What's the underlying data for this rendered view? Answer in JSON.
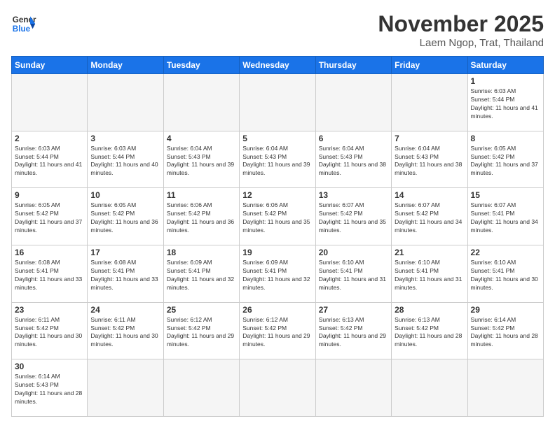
{
  "header": {
    "logo_general": "General",
    "logo_blue": "Blue",
    "month_title": "November 2025",
    "location": "Laem Ngop, Trat, Thailand"
  },
  "days_of_week": [
    "Sunday",
    "Monday",
    "Tuesday",
    "Wednesday",
    "Thursday",
    "Friday",
    "Saturday"
  ],
  "weeks": [
    [
      {
        "day": "",
        "empty": true
      },
      {
        "day": "",
        "empty": true
      },
      {
        "day": "",
        "empty": true
      },
      {
        "day": "",
        "empty": true
      },
      {
        "day": "",
        "empty": true
      },
      {
        "day": "",
        "empty": true
      },
      {
        "day": "1",
        "sunrise": "6:03 AM",
        "sunset": "5:44 PM",
        "daylight": "11 hours and 41 minutes."
      }
    ],
    [
      {
        "day": "2",
        "sunrise": "6:03 AM",
        "sunset": "5:44 PM",
        "daylight": "11 hours and 41 minutes."
      },
      {
        "day": "3",
        "sunrise": "6:03 AM",
        "sunset": "5:44 PM",
        "daylight": "11 hours and 40 minutes."
      },
      {
        "day": "4",
        "sunrise": "6:04 AM",
        "sunset": "5:43 PM",
        "daylight": "11 hours and 39 minutes."
      },
      {
        "day": "5",
        "sunrise": "6:04 AM",
        "sunset": "5:43 PM",
        "daylight": "11 hours and 39 minutes."
      },
      {
        "day": "6",
        "sunrise": "6:04 AM",
        "sunset": "5:43 PM",
        "daylight": "11 hours and 38 minutes."
      },
      {
        "day": "7",
        "sunrise": "6:04 AM",
        "sunset": "5:43 PM",
        "daylight": "11 hours and 38 minutes."
      },
      {
        "day": "8",
        "sunrise": "6:05 AM",
        "sunset": "5:42 PM",
        "daylight": "11 hours and 37 minutes."
      }
    ],
    [
      {
        "day": "9",
        "sunrise": "6:05 AM",
        "sunset": "5:42 PM",
        "daylight": "11 hours and 37 minutes."
      },
      {
        "day": "10",
        "sunrise": "6:05 AM",
        "sunset": "5:42 PM",
        "daylight": "11 hours and 36 minutes."
      },
      {
        "day": "11",
        "sunrise": "6:06 AM",
        "sunset": "5:42 PM",
        "daylight": "11 hours and 36 minutes."
      },
      {
        "day": "12",
        "sunrise": "6:06 AM",
        "sunset": "5:42 PM",
        "daylight": "11 hours and 35 minutes."
      },
      {
        "day": "13",
        "sunrise": "6:07 AM",
        "sunset": "5:42 PM",
        "daylight": "11 hours and 35 minutes."
      },
      {
        "day": "14",
        "sunrise": "6:07 AM",
        "sunset": "5:42 PM",
        "daylight": "11 hours and 34 minutes."
      },
      {
        "day": "15",
        "sunrise": "6:07 AM",
        "sunset": "5:41 PM",
        "daylight": "11 hours and 34 minutes."
      }
    ],
    [
      {
        "day": "16",
        "sunrise": "6:08 AM",
        "sunset": "5:41 PM",
        "daylight": "11 hours and 33 minutes."
      },
      {
        "day": "17",
        "sunrise": "6:08 AM",
        "sunset": "5:41 PM",
        "daylight": "11 hours and 33 minutes."
      },
      {
        "day": "18",
        "sunrise": "6:09 AM",
        "sunset": "5:41 PM",
        "daylight": "11 hours and 32 minutes."
      },
      {
        "day": "19",
        "sunrise": "6:09 AM",
        "sunset": "5:41 PM",
        "daylight": "11 hours and 32 minutes."
      },
      {
        "day": "20",
        "sunrise": "6:10 AM",
        "sunset": "5:41 PM",
        "daylight": "11 hours and 31 minutes."
      },
      {
        "day": "21",
        "sunrise": "6:10 AM",
        "sunset": "5:41 PM",
        "daylight": "11 hours and 31 minutes."
      },
      {
        "day": "22",
        "sunrise": "6:10 AM",
        "sunset": "5:41 PM",
        "daylight": "11 hours and 30 minutes."
      }
    ],
    [
      {
        "day": "23",
        "sunrise": "6:11 AM",
        "sunset": "5:42 PM",
        "daylight": "11 hours and 30 minutes."
      },
      {
        "day": "24",
        "sunrise": "6:11 AM",
        "sunset": "5:42 PM",
        "daylight": "11 hours and 30 minutes."
      },
      {
        "day": "25",
        "sunrise": "6:12 AM",
        "sunset": "5:42 PM",
        "daylight": "11 hours and 29 minutes."
      },
      {
        "day": "26",
        "sunrise": "6:12 AM",
        "sunset": "5:42 PM",
        "daylight": "11 hours and 29 minutes."
      },
      {
        "day": "27",
        "sunrise": "6:13 AM",
        "sunset": "5:42 PM",
        "daylight": "11 hours and 29 minutes."
      },
      {
        "day": "28",
        "sunrise": "6:13 AM",
        "sunset": "5:42 PM",
        "daylight": "11 hours and 28 minutes."
      },
      {
        "day": "29",
        "sunrise": "6:14 AM",
        "sunset": "5:42 PM",
        "daylight": "11 hours and 28 minutes."
      }
    ],
    [
      {
        "day": "30",
        "sunrise": "6:14 AM",
        "sunset": "5:43 PM",
        "daylight": "11 hours and 28 minutes."
      },
      {
        "day": "",
        "empty": true
      },
      {
        "day": "",
        "empty": true
      },
      {
        "day": "",
        "empty": true
      },
      {
        "day": "",
        "empty": true
      },
      {
        "day": "",
        "empty": true
      },
      {
        "day": "",
        "empty": true
      }
    ]
  ]
}
